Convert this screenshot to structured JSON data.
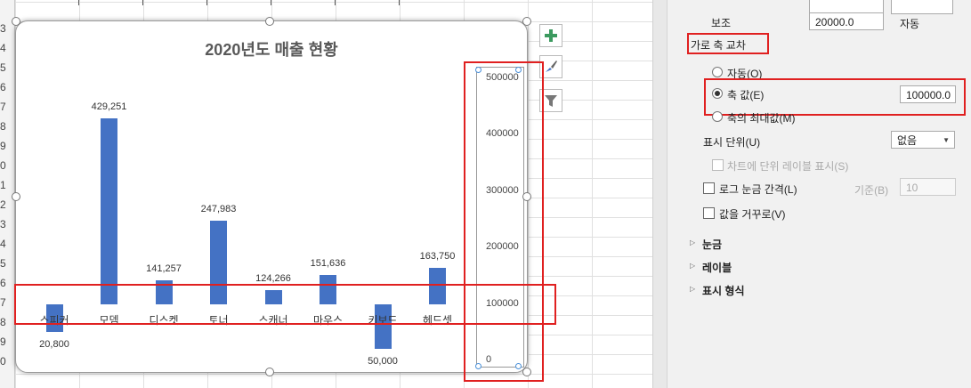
{
  "row_numbers": [
    "3",
    "4",
    "5",
    "6",
    "7",
    "8",
    "9",
    "0",
    "1",
    "2",
    "3",
    "4",
    "5",
    "6",
    "7",
    "8",
    "9",
    "0"
  ],
  "chart": {
    "title": "2020년도 매출 현황",
    "buttons": {
      "add": "+",
      "style": "brush",
      "filter": "filter"
    },
    "colors": {
      "bar": "#4472c4",
      "highlight": "#e02020"
    }
  },
  "chart_data": {
    "type": "bar",
    "title": "2020년도 매출 현황",
    "categories": [
      "스피커",
      "모뎀",
      "디스켓",
      "토너",
      "스캐너",
      "마우스",
      "키보드",
      "헤드셋"
    ],
    "values": [
      -20800,
      429251,
      141257,
      247983,
      124266,
      151636,
      -50000,
      163750
    ],
    "data_labels": [
      "20,800",
      "429,251",
      "141,257",
      "247,983",
      "124,266",
      "151,636",
      "50,000",
      "163,750"
    ],
    "y_ticks": [
      "500000",
      "400000",
      "300000",
      "200000",
      "100000",
      "0"
    ],
    "ylim": [
      0,
      500000
    ],
    "horizontal_axis_crosses": 100000,
    "grid": false,
    "legend": "none"
  },
  "panel": {
    "minor_label": "보조",
    "minor_value": "20000.0",
    "minor_auto": "자동",
    "section_label": "가로 축 교차",
    "radio_auto": "자동(O)",
    "radio_axis_value": "축 값(E)",
    "axis_value_input": "100000.0",
    "radio_max": "축의 최대값(M)",
    "display_units_label": "표시 단위(U)",
    "display_units_value": "없음",
    "show_units_label": "차트에 단위 레이블 표시(S)",
    "log_scale_label": "로그 눈금 간격(L)",
    "log_base_label": "기준(B)",
    "log_base_value": "10",
    "reverse_label": "값을 거꾸로(V)",
    "collapsed_sections": [
      "눈금",
      "레이블",
      "표시 형식"
    ]
  }
}
